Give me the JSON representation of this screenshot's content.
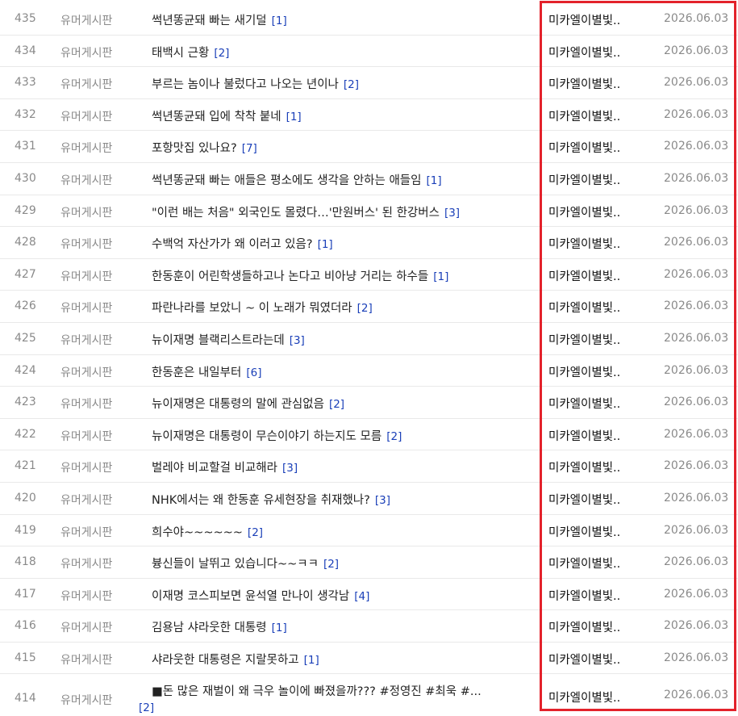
{
  "colors": {
    "highlight": "#e3222b",
    "comment_count": "#1a3fb8",
    "meta_text": "#8a8a8a"
  },
  "rows": [
    {
      "num": "435",
      "category": "유머게시판",
      "title": "썩년똥균돼 빠는 새기덜",
      "comments": "[1]",
      "author": "미카엘이별빛..",
      "date": "2026.06.03"
    },
    {
      "num": "434",
      "category": "유머게시판",
      "title": "태백시 근황",
      "comments": "[2]",
      "author": "미카엘이별빛..",
      "date": "2026.06.03"
    },
    {
      "num": "433",
      "category": "유머게시판",
      "title": "부르는 놈이나 불렀다고 나오는 년이나",
      "comments": "[2]",
      "author": "미카엘이별빛..",
      "date": "2026.06.03"
    },
    {
      "num": "432",
      "category": "유머게시판",
      "title": "썩년똥균돼 입에 착착 붙네",
      "comments": "[1]",
      "author": "미카엘이별빛..",
      "date": "2026.06.03"
    },
    {
      "num": "431",
      "category": "유머게시판",
      "title": "포항맛집 있나요?",
      "comments": "[7]",
      "author": "미카엘이별빛..",
      "date": "2026.06.03"
    },
    {
      "num": "430",
      "category": "유머게시판",
      "title": "썩년똥균돼 빠는 애들은 평소에도 생각을 안하는 애들임",
      "comments": "[1]",
      "author": "미카엘이별빛..",
      "date": "2026.06.03"
    },
    {
      "num": "429",
      "category": "유머게시판",
      "title": "\"이런 배는 처음\" 외국인도 몰렸다…'만원버스' 된 한강버스",
      "comments": "[3]",
      "author": "미카엘이별빛..",
      "date": "2026.06.03"
    },
    {
      "num": "428",
      "category": "유머게시판",
      "title": "수백억 자산가가 왜 이러고 있음?",
      "comments": "[1]",
      "author": "미카엘이별빛..",
      "date": "2026.06.03"
    },
    {
      "num": "427",
      "category": "유머게시판",
      "title": "한동훈이 어린학생들하고나 논다고 비아냥 거리는 하수들",
      "comments": "[1]",
      "author": "미카엘이별빛..",
      "date": "2026.06.03"
    },
    {
      "num": "426",
      "category": "유머게시판",
      "title": "파란나라를 보았니 ~ 이 노래가 뭐였더라",
      "comments": "[2]",
      "author": "미카엘이별빛..",
      "date": "2026.06.03"
    },
    {
      "num": "425",
      "category": "유머게시판",
      "title": "뉴이재명 블랙리스트라는데",
      "comments": "[3]",
      "author": "미카엘이별빛..",
      "date": "2026.06.03"
    },
    {
      "num": "424",
      "category": "유머게시판",
      "title": "한동훈은 내일부터",
      "comments": "[6]",
      "author": "미카엘이별빛..",
      "date": "2026.06.03"
    },
    {
      "num": "423",
      "category": "유머게시판",
      "title": "뉴이재명은 대통령의 말에 관심없음",
      "comments": "[2]",
      "author": "미카엘이별빛..",
      "date": "2026.06.03"
    },
    {
      "num": "422",
      "category": "유머게시판",
      "title": "뉴이재명은 대통령이 무슨이야기 하는지도 모름",
      "comments": "[2]",
      "author": "미카엘이별빛..",
      "date": "2026.06.03"
    },
    {
      "num": "421",
      "category": "유머게시판",
      "title": "벌레야 비교할걸 비교해라",
      "comments": "[3]",
      "author": "미카엘이별빛..",
      "date": "2026.06.03"
    },
    {
      "num": "420",
      "category": "유머게시판",
      "title": "NHK에서는 왜 한동훈 유세현장을 취재했나?",
      "comments": "[3]",
      "author": "미카엘이별빛..",
      "date": "2026.06.03"
    },
    {
      "num": "419",
      "category": "유머게시판",
      "title": "희수야~~~~~~",
      "comments": "[2]",
      "author": "미카엘이별빛..",
      "date": "2026.06.03"
    },
    {
      "num": "418",
      "category": "유머게시판",
      "title": "븅신들이 날뛰고 있습니다~~ㅋㅋ",
      "comments": "[2]",
      "author": "미카엘이별빛..",
      "date": "2026.06.03"
    },
    {
      "num": "417",
      "category": "유머게시판",
      "title": "이재명 코스피보면 윤석열 만나이 생각남",
      "comments": "[4]",
      "author": "미카엘이별빛..",
      "date": "2026.06.03"
    },
    {
      "num": "416",
      "category": "유머게시판",
      "title": "김용남 샤라웃한 대통령",
      "comments": "[1]",
      "author": "미카엘이별빛..",
      "date": "2026.06.03"
    },
    {
      "num": "415",
      "category": "유머게시판",
      "title": "샤라웃한 대통령은 지랄못하고",
      "comments": "[1]",
      "author": "미카엘이별빛..",
      "date": "2026.06.03"
    },
    {
      "num": "414",
      "category": "유머게시판",
      "title": "■돈 많은 재벌이 왜 극우 놀이에 빠졌을까??? #정영진 #최욱 #...",
      "comments": "[2]",
      "author": "미카엘이별빛..",
      "date": "2026.06.03",
      "wrap": true
    }
  ]
}
